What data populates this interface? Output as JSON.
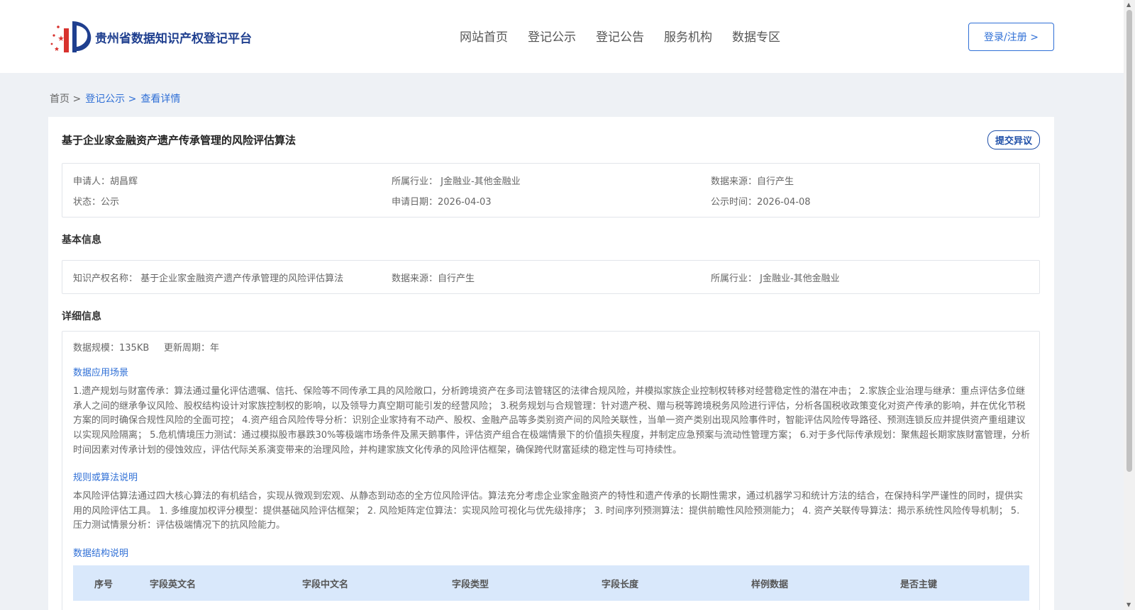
{
  "header": {
    "site_name": "贵州省数据知识产权登记平台",
    "nav": [
      "网站首页",
      "登记公示",
      "登记公告",
      "服务机构",
      "数据专区"
    ],
    "login_label": "登录/注册 >"
  },
  "breadcrumb": {
    "home": "首页 >",
    "publicity": "登记公示 >",
    "current": "查看详情"
  },
  "record": {
    "title": "基于企业家金融资产遗产传承管理的风险评估算法",
    "objection_label": "提交异议",
    "summary": {
      "applicant": "申请人：胡昌辉",
      "industry": "所属行业： J金融业-其他金融业",
      "source": "数据来源：自行产生",
      "status": "状态：公示",
      "apply_date": "申请日期：2026-04-03",
      "publicity_time": "公示时间：2026-04-08"
    }
  },
  "basic": {
    "section_title": "基本信息",
    "ip_name": "知识产权名称： 基于企业家金融资产遗产传承管理的风险评估算法",
    "source": "数据来源：自行产生",
    "industry": "所属行业： J金融业-其他金融业"
  },
  "detail": {
    "section_title": "详细信息",
    "scale": "数据规模：135KB",
    "update_cycle": "更新周期：年",
    "scenario_title": "数据应用场景",
    "scenario_text": "1.遗产规划与财富传承：算法通过量化评估遗嘱、信托、保险等不同传承工具的风险敞口，分析跨境资产在多司法管辖区的法律合规风险，并模拟家族企业控制权转移对经营稳定性的潜在冲击； 2.家族企业治理与继承：重点评估多位继承人之间的继承争议风险、股权结构设计对家族控制权的影响，以及领导力真空期可能引发的经营风险； 3.税务规划与合规管理：针对遗产税、赠与税等跨境税务风险进行评估，分析各国税收政策变化对资产传承的影响，并在优化节税方案的同时确保合规性风险的全面可控； 4.资产组合风险传导分析：识别企业家持有不动产、股权、金融产品等多类别资产间的风险关联性，当单一资产类别出现风险事件时，智能评估风险传导路径、预测连锁反应并提供资产重组建议以实现风险隔离； 5.危机情境压力测试：通过模拟股市暴跌30%等极端市场条件及黑天鹅事件，评估资产组合在极端情景下的价值损失程度，并制定应急预案与流动性管理方案； 6.对于多代际传承规划：聚焦超长期家族财富管理，分析时间因素对传承计划的侵蚀效应，评估代际关系演变带来的治理风险，并构建家族文化传承的风险评估框架，确保跨代财富延续的稳定性与可持续性。",
    "algorithm_title": "规则或算法说明",
    "algorithm_text": "本风险评估算法通过四大核心算法的有机结合，实现从微观到宏观、从静态到动态的全方位风险评估。算法充分考虑企业家金融资产的特性和遗产传承的长期性需求，通过机器学习和统计方法的结合，在保持科学严谨性的同时，提供实用的风险评估工具。 1. 多维度加权评分模型：提供基础风险评估框架； 2. 风险矩阵定位算法：实现风险可视化与优先级排序； 3. 时间序列预测算法：提供前瞻性风险预测能力； 4. 资产关联传导算法：揭示系统性风险传导机制； 5. 压力测试情景分析：评估极端情况下的抗风险能力。",
    "structure_title": "数据结构说明",
    "table_headers": [
      "序号",
      "字段英文名",
      "字段中文名",
      "字段类型",
      "字段长度",
      "样例数据",
      "是否主键"
    ]
  },
  "colors": {
    "brand": "#1f3f8f",
    "accent": "#2f6fd6",
    "page_bg": "#eef1f5",
    "table_header_bg": "#d9e8fb"
  }
}
